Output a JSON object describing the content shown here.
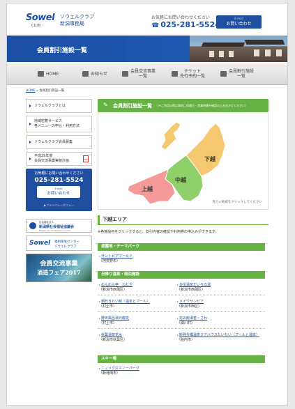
{
  "header": {
    "logo_word": "Sowel",
    "logo_sub": "CLUB",
    "brand_line1": "ソウェルクラブ",
    "brand_line2": "新潟事務局",
    "contact_note": "お気軽にお問い合わせください",
    "phone": "025-281-5524",
    "contact_btn_small": "E-mail",
    "contact_btn_label": "お問い合わせ"
  },
  "banner": {
    "title": "会員割引施設一覧"
  },
  "nav": {
    "items": [
      {
        "label": "HOME",
        "icon": "home-icon"
      },
      {
        "label": "お知らせ",
        "icon": "notice-icon"
      },
      {
        "label": "会員交流事業\n一覧",
        "icon": "exchange-icon"
      },
      {
        "label": "チケット\n先行予約一覧",
        "icon": "ticket-icon"
      },
      {
        "label": "会員割引施設\n一覧",
        "icon": "discount-icon"
      }
    ]
  },
  "breadcrumb": {
    "home": "HOME",
    "sep": "»",
    "current": "会員割引施設一覧"
  },
  "sidebar": {
    "items": [
      {
        "label": "ソウェルクラブとは"
      },
      {
        "label": "地域密着サービス\n各メニューの申込・利用方法"
      },
      {
        "label": "ソウェルクラブ会員募集"
      },
      {
        "label": "平成29年度\n会員交流事業実施計画"
      }
    ],
    "contact": {
      "note": "お気軽にお問い合わせください",
      "phone": "025-281-5524",
      "btn_small": "E-mail",
      "btn_label": "お問い合わせ",
      "privacy": "▶プライバシーポリシー"
    },
    "banners": [
      {
        "line1": "社会福祉法人",
        "line2": "新潟県社会福祉協議会",
        "line3": "Niigata Social Welfare Council"
      },
      {
        "logo": "Sowel",
        "line1": "福利厚生センター",
        "line2": "ソウェルクラブ"
      },
      {
        "line1": "会員交流事業",
        "line2": "酒造フェア2017"
      }
    ]
  },
  "map": {
    "header_title": "会員割引施設一覧",
    "header_note": "（＊ご利用の際は事前に休館日・営業時間を確認の上お出かけください）",
    "regions": [
      {
        "name": "下越",
        "color": "#f6c870"
      },
      {
        "name": "中越",
        "color": "#8fd06a"
      },
      {
        "name": "上越",
        "color": "#f59a9a"
      }
    ],
    "island_color": "#f6c870",
    "hint": "見たい地域をクリックしてください"
  },
  "area": {
    "title": "下越エリア",
    "note": "※各施設名をクリックすると、割引内容の確認や利用券の申込みができます。"
  },
  "categories": [
    {
      "title": "遊園地・テーマパーク",
      "facilities": [
        {
          "name": "サントピアワールド",
          "loc": "（阿賀野市）"
        }
      ]
    },
    {
      "title": "日帰り温泉・宿泊施設",
      "facilities": [
        {
          "name": "めんめん亭　わたや",
          "loc": "（新潟市西蒲区）"
        },
        {
          "name": "多宝温泉だいろの湯",
          "loc": "（新潟市西蒲区）"
        },
        {
          "name": "朝日きれい館（温泉とプール）",
          "loc": "（村上市）"
        },
        {
          "name": "メイワサンピア",
          "loc": "（新潟市西区）"
        },
        {
          "name": "野天風呂湯元龍泉",
          "loc": "（村上市）"
        },
        {
          "name": "花の館湯若・さわ",
          "loc": "（関川村）"
        },
        {
          "name": "秋葉温泉花水",
          "loc": "（新潟市秋葉区）"
        },
        {
          "name": "新発今橋温泉クアハウスたいない（プールと温泉）",
          "loc": "（胎内市）"
        }
      ]
    },
    {
      "title": "スキー場",
      "facilities": [
        {
          "name": "ニノックススノーパーク",
          "loc": "（新発田市）"
        }
      ]
    }
  ]
}
